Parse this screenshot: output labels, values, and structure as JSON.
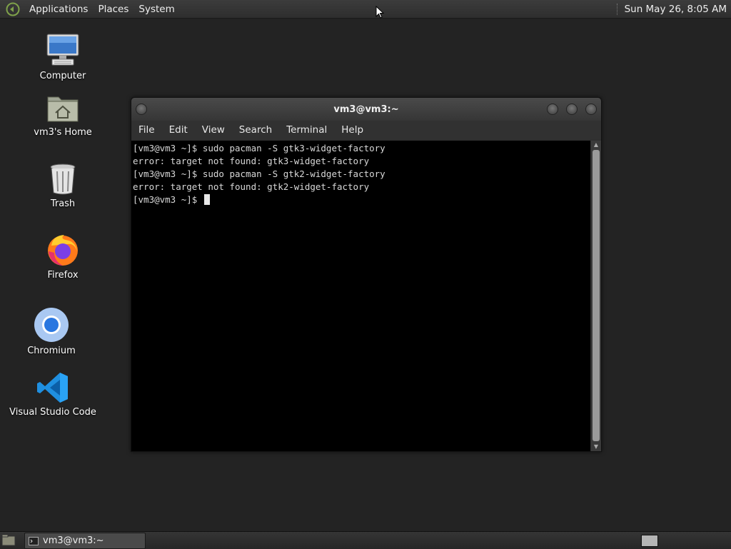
{
  "top_panel": {
    "menus": [
      "Applications",
      "Places",
      "System"
    ],
    "clock": "Sun May 26,  8:05 AM"
  },
  "desktop_icons": [
    {
      "label": "Computer",
      "icon": "computer-icon"
    },
    {
      "label": "vm3's Home",
      "icon": "home-folder-icon"
    },
    {
      "label": "Trash",
      "icon": "trash-icon"
    },
    {
      "label": "Firefox",
      "icon": "firefox-icon"
    },
    {
      "label": "Chromium",
      "icon": "chromium-icon"
    },
    {
      "label": "Visual Studio Code",
      "icon": "vscode-icon"
    }
  ],
  "terminal": {
    "title": "vm3@vm3:~",
    "menu": [
      "File",
      "Edit",
      "View",
      "Search",
      "Terminal",
      "Help"
    ],
    "lines": [
      "[vm3@vm3 ~]$ sudo pacman -S gtk3-widget-factory",
      "error: target not found: gtk3-widget-factory",
      "[vm3@vm3 ~]$ sudo pacman -S gtk2-widget-factory",
      "error: target not found: gtk2-widget-factory"
    ],
    "prompt": "[vm3@vm3 ~]$ "
  },
  "taskbar": {
    "window_label": "vm3@vm3:~"
  },
  "colors": {
    "desktop_bg": "#232323",
    "panel_bg": "#333333",
    "terminal_bg": "#000000",
    "terminal_fg": "#d8d8d8"
  }
}
